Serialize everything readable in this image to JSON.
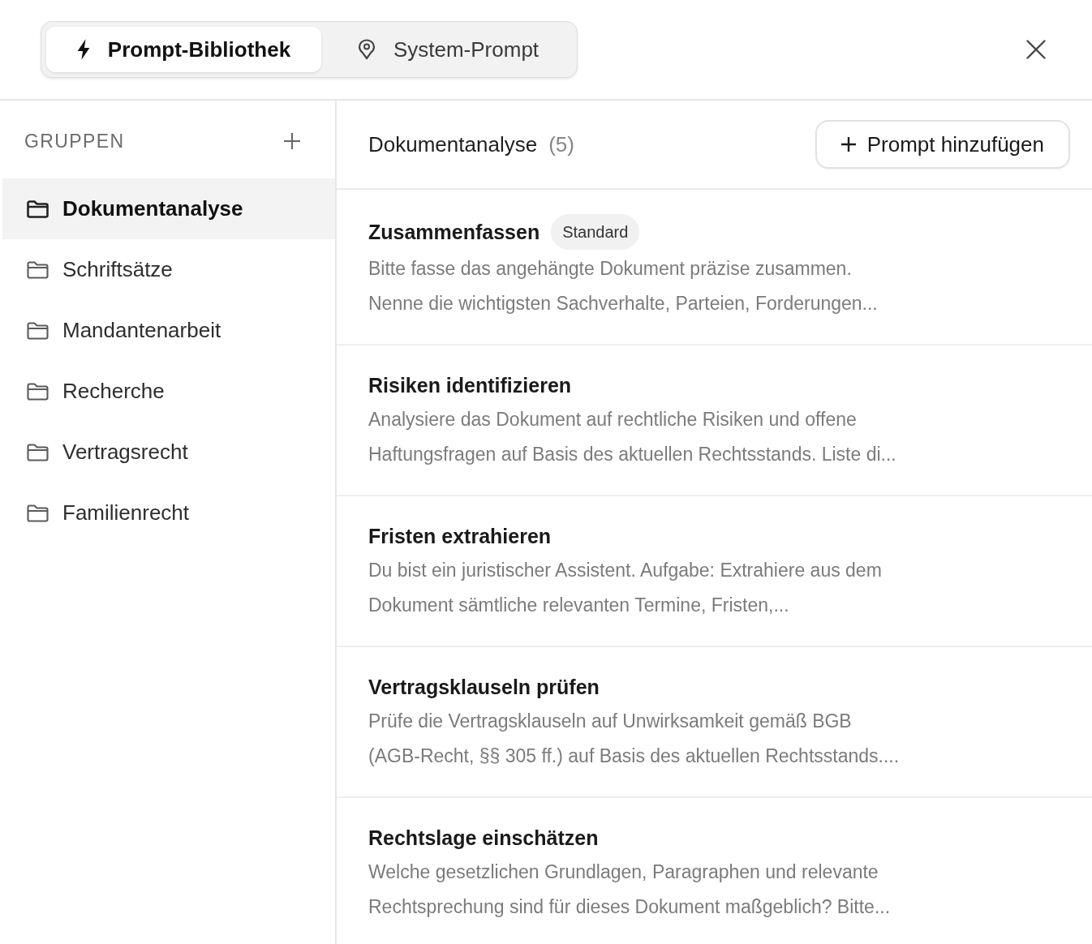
{
  "tabs": [
    {
      "label": "Prompt-Bibliothek",
      "selected": true
    },
    {
      "label": "System-Prompt",
      "selected": false
    }
  ],
  "sidebar": {
    "heading": "GRUPPEN",
    "groups": [
      {
        "label": "Dokumentanalyse",
        "selected": true
      },
      {
        "label": "Schriftsätze",
        "selected": false
      },
      {
        "label": "Mandantenarbeit",
        "selected": false
      },
      {
        "label": "Recherche",
        "selected": false
      },
      {
        "label": "Vertragsrecht",
        "selected": false
      },
      {
        "label": "Familienrecht",
        "selected": false
      }
    ]
  },
  "main": {
    "title": "Dokumentanalyse",
    "count": "(5)",
    "add_button": "Prompt hinzufügen",
    "prompts": [
      {
        "title": "Zusammenfassen",
        "badge": "Standard",
        "description": [
          "Bitte fasse das angehängte Dokument präzise zusammen.",
          "Nenne die wichtigsten Sachverhalte, Parteien, Forderungen..."
        ]
      },
      {
        "title": "Risiken identifizieren",
        "description": [
          "Analysiere das Dokument auf rechtliche Risiken und offene",
          "Haftungsfragen auf Basis des aktuellen Rechtsstands. Liste di..."
        ]
      },
      {
        "title": "Fristen extrahieren",
        "description": [
          "Du bist ein juristischer Assistent. Aufgabe: Extrahiere aus dem",
          "Dokument sämtliche relevanten Termine, Fristen,..."
        ]
      },
      {
        "title": "Vertragsklauseln prüfen",
        "description": [
          "Prüfe die Vertragsklauseln auf Unwirksamkeit gemäß BGB",
          "(AGB-Recht, §§ 305 ff.) auf Basis des aktuellen Rechtsstands...."
        ]
      },
      {
        "title": "Rechtslage einschätzen",
        "description": [
          "Welche gesetzlichen Grundlagen, Paragraphen und relevante",
          "Rechtsprechung sind für dieses Dokument maßgeblich? Bitte..."
        ]
      }
    ]
  }
}
